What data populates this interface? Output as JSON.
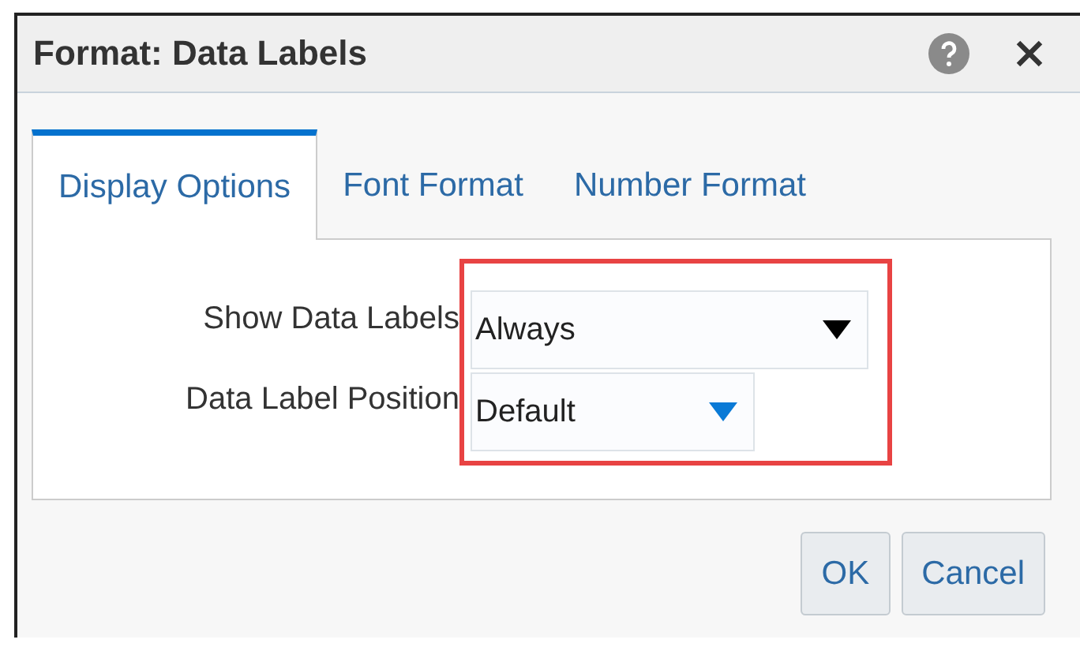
{
  "window": {
    "title": "Format: Data Labels"
  },
  "tabs": [
    {
      "label": "Display Options",
      "selected": true
    },
    {
      "label": "Font Format",
      "selected": false
    },
    {
      "label": "Number Format",
      "selected": false
    }
  ],
  "fields": [
    {
      "label": "Show Data Labels",
      "value": "Always",
      "focused": true,
      "wide": true
    },
    {
      "label": "Data Label Position",
      "value": "Default",
      "focused": false,
      "wide": false
    }
  ],
  "buttons": [
    "OK",
    "Cancel"
  ]
}
